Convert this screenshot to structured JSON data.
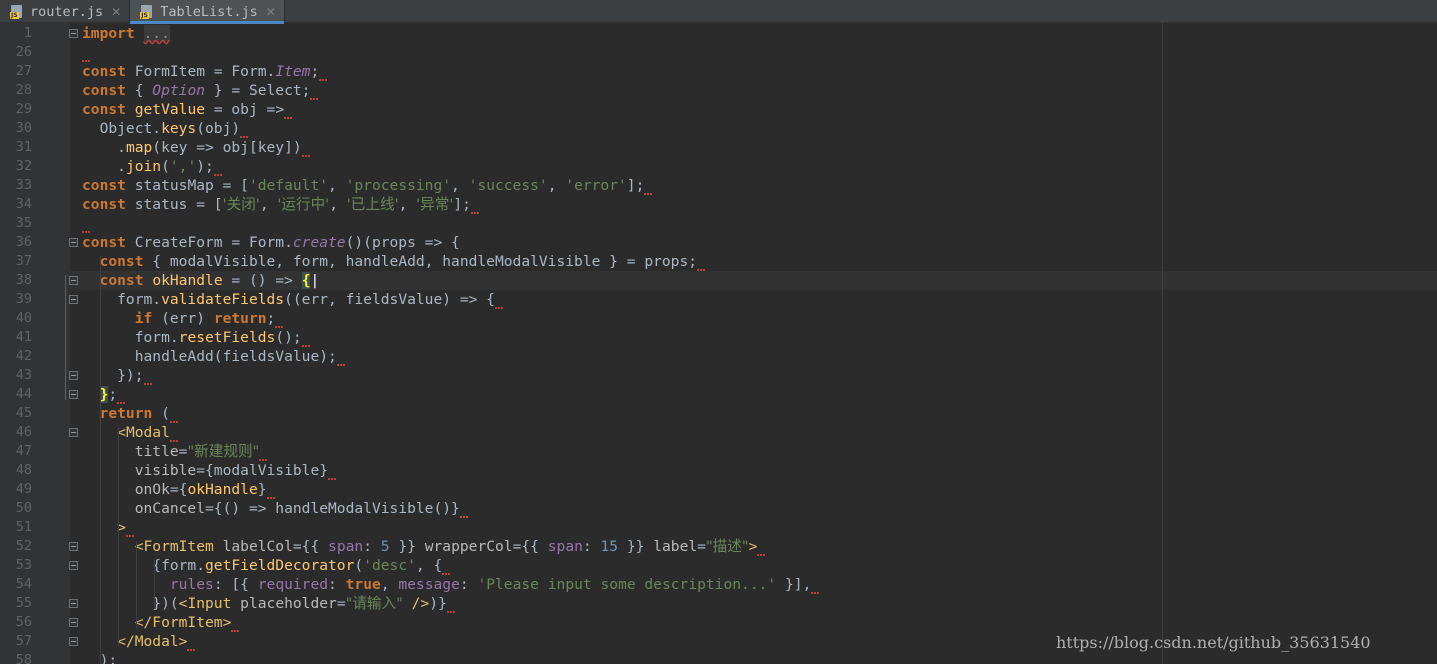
{
  "tabs": [
    {
      "label": "router.js",
      "icon": "js-file-icon",
      "active": false
    },
    {
      "label": "TableList.js",
      "icon": "js-file-icon",
      "active": true
    }
  ],
  "colors": {
    "background": "#2b2b2b",
    "keyword": "#cc7832",
    "string": "#6a8759",
    "number": "#6897bb",
    "property": "#9876aa",
    "function": "#ffc66d",
    "jsx_tag": "#e8bf6a"
  },
  "current_line": "38",
  "watermark": "https://blog.csdn.net/github_35631540",
  "lines": [
    {
      "n": "1",
      "fold": true,
      "tokens": [
        [
          "kw",
          "import"
        ],
        [
          "p",
          " "
        ],
        [
          "fold",
          "..."
        ]
      ]
    },
    {
      "n": "26",
      "tokens": [
        [
          "sq",
          ""
        ]
      ]
    },
    {
      "n": "27",
      "tokens": [
        [
          "kw",
          "const"
        ],
        [
          "p",
          " FormItem = Form."
        ],
        [
          "ital",
          "Item"
        ],
        [
          "p",
          ";"
        ],
        [
          "sq",
          ""
        ]
      ]
    },
    {
      "n": "28",
      "tokens": [
        [
          "kw",
          "const"
        ],
        [
          "p",
          " { "
        ],
        [
          "ital",
          "Option"
        ],
        [
          "p",
          " } = Select;"
        ],
        [
          "sq",
          ""
        ]
      ]
    },
    {
      "n": "29",
      "tokens": [
        [
          "kw",
          "const"
        ],
        [
          "p",
          " "
        ],
        [
          "fn",
          "getValue"
        ],
        [
          "p",
          " = obj =>"
        ],
        [
          "sq",
          ""
        ]
      ]
    },
    {
      "n": "30",
      "tokens": [
        [
          "p",
          "  Object."
        ],
        [
          "fn",
          "keys"
        ],
        [
          "p",
          "(obj)"
        ],
        [
          "sq",
          ""
        ]
      ]
    },
    {
      "n": "31",
      "tokens": [
        [
          "p",
          "    ."
        ],
        [
          "fn",
          "map"
        ],
        [
          "p",
          "(key => obj[key])"
        ],
        [
          "sq",
          ""
        ]
      ]
    },
    {
      "n": "32",
      "tokens": [
        [
          "p",
          "    ."
        ],
        [
          "fn",
          "join"
        ],
        [
          "p",
          "("
        ],
        [
          "str",
          "','"
        ],
        [
          "p",
          ");"
        ],
        [
          "sq",
          ""
        ]
      ]
    },
    {
      "n": "33",
      "tokens": [
        [
          "kw",
          "const"
        ],
        [
          "p",
          " statusMap = ["
        ],
        [
          "str",
          "'default'"
        ],
        [
          "p",
          ", "
        ],
        [
          "str",
          "'processing'"
        ],
        [
          "p",
          ", "
        ],
        [
          "str",
          "'success'"
        ],
        [
          "p",
          ", "
        ],
        [
          "str",
          "'error'"
        ],
        [
          "p",
          "];"
        ],
        [
          "sq",
          ""
        ]
      ]
    },
    {
      "n": "34",
      "tokens": [
        [
          "kw",
          "const"
        ],
        [
          "p",
          " status = ["
        ],
        [
          "str",
          "'关闭'"
        ],
        [
          "p",
          ", "
        ],
        [
          "str",
          "'运行中'"
        ],
        [
          "p",
          ", "
        ],
        [
          "str",
          "'已上线'"
        ],
        [
          "p",
          ", "
        ],
        [
          "str",
          "'异常'"
        ],
        [
          "p",
          "];"
        ],
        [
          "sq",
          ""
        ]
      ]
    },
    {
      "n": "35",
      "tokens": [
        [
          "sq",
          ""
        ]
      ]
    },
    {
      "n": "36",
      "fold": true,
      "tokens": [
        [
          "kw",
          "const"
        ],
        [
          "p",
          " CreateForm = Form."
        ],
        [
          "ital",
          "create"
        ],
        [
          "p",
          "()(props => {"
        ]
      ]
    },
    {
      "n": "37",
      "tokens": [
        [
          "p",
          "  "
        ],
        [
          "kw",
          "const"
        ],
        [
          "p",
          " { modalVisible, form, handleAdd, handleModalVisible } = props;"
        ],
        [
          "sq",
          ""
        ]
      ]
    },
    {
      "n": "38",
      "fold": true,
      "tokens": [
        [
          "p",
          "  "
        ],
        [
          "kw",
          "const"
        ],
        [
          "p",
          " "
        ],
        [
          "fn",
          "okHandle"
        ],
        [
          "p",
          " = () => "
        ],
        [
          "match",
          "{"
        ],
        [
          "caret",
          "|"
        ]
      ]
    },
    {
      "n": "39",
      "fold": true,
      "tokens": [
        [
          "p",
          "    form."
        ],
        [
          "fn",
          "validateFields"
        ],
        [
          "p",
          "((err, fieldsValue) => {"
        ],
        [
          "sq",
          ""
        ]
      ]
    },
    {
      "n": "40",
      "tokens": [
        [
          "p",
          "      "
        ],
        [
          "kw",
          "if"
        ],
        [
          "p",
          " (err) "
        ],
        [
          "kw",
          "return"
        ],
        [
          "p",
          ";"
        ],
        [
          "sq",
          ""
        ]
      ]
    },
    {
      "n": "41",
      "tokens": [
        [
          "p",
          "      form."
        ],
        [
          "fn",
          "resetFields"
        ],
        [
          "p",
          "();"
        ],
        [
          "sq",
          ""
        ]
      ]
    },
    {
      "n": "42",
      "tokens": [
        [
          "p",
          "      handleAdd(fieldsValue);"
        ],
        [
          "sq",
          ""
        ]
      ]
    },
    {
      "n": "43",
      "fold": true,
      "tokens": [
        [
          "p",
          "    });"
        ],
        [
          "sq",
          ""
        ]
      ]
    },
    {
      "n": "44",
      "fold": true,
      "tokens": [
        [
          "p",
          "  "
        ],
        [
          "match",
          "}"
        ],
        [
          "p",
          ";"
        ],
        [
          "sq",
          ""
        ]
      ]
    },
    {
      "n": "45",
      "tokens": [
        [
          "p",
          "  "
        ],
        [
          "kw",
          "return"
        ],
        [
          "p",
          " ("
        ],
        [
          "sq",
          ""
        ]
      ]
    },
    {
      "n": "46",
      "fold": true,
      "tokens": [
        [
          "p",
          "    "
        ],
        [
          "tag",
          "<Modal"
        ],
        [
          "sq",
          ""
        ]
      ]
    },
    {
      "n": "47",
      "tokens": [
        [
          "p",
          "      "
        ],
        [
          "attr",
          "title"
        ],
        [
          "p",
          "="
        ],
        [
          "str",
          "\"新建规则\""
        ],
        [
          "sq",
          ""
        ]
      ]
    },
    {
      "n": "48",
      "tokens": [
        [
          "p",
          "      "
        ],
        [
          "attr",
          "visible"
        ],
        [
          "p",
          "={modalVisible}"
        ],
        [
          "sq",
          ""
        ]
      ]
    },
    {
      "n": "49",
      "tokens": [
        [
          "p",
          "      "
        ],
        [
          "attr",
          "onOk"
        ],
        [
          "p",
          "={"
        ],
        [
          "fn",
          "okHandle"
        ],
        [
          "p",
          "}"
        ],
        [
          "sq",
          ""
        ]
      ]
    },
    {
      "n": "50",
      "tokens": [
        [
          "p",
          "      "
        ],
        [
          "attr",
          "onCancel"
        ],
        [
          "p",
          "={() => handleModalVisible()}"
        ],
        [
          "sq",
          ""
        ]
      ]
    },
    {
      "n": "51",
      "tokens": [
        [
          "p",
          "    "
        ],
        [
          "tag",
          ">"
        ],
        [
          "sq",
          ""
        ]
      ]
    },
    {
      "n": "52",
      "fold": true,
      "tokens": [
        [
          "p",
          "      "
        ],
        [
          "tag",
          "<FormItem"
        ],
        [
          "p",
          " "
        ],
        [
          "attr",
          "labelCol"
        ],
        [
          "p",
          "={{ "
        ],
        [
          "prop",
          "span"
        ],
        [
          "p",
          ": "
        ],
        [
          "num",
          "5"
        ],
        [
          "p",
          " }} "
        ],
        [
          "attr",
          "wrapperCol"
        ],
        [
          "p",
          "={{ "
        ],
        [
          "prop",
          "span"
        ],
        [
          "p",
          ": "
        ],
        [
          "num",
          "15"
        ],
        [
          "p",
          " }} "
        ],
        [
          "attr",
          "label"
        ],
        [
          "p",
          "="
        ],
        [
          "str",
          "\"描述\""
        ],
        [
          "tag",
          ">"
        ],
        [
          "sq",
          ""
        ]
      ]
    },
    {
      "n": "53",
      "fold": true,
      "tokens": [
        [
          "p",
          "        {form."
        ],
        [
          "fn",
          "getFieldDecorator"
        ],
        [
          "p",
          "("
        ],
        [
          "str",
          "'desc'"
        ],
        [
          "p",
          ", {"
        ],
        [
          "sq",
          ""
        ]
      ]
    },
    {
      "n": "54",
      "tokens": [
        [
          "p",
          "          "
        ],
        [
          "prop",
          "rules"
        ],
        [
          "p",
          ": [{ "
        ],
        [
          "prop",
          "required"
        ],
        [
          "p",
          ": "
        ],
        [
          "kw",
          "true"
        ],
        [
          "p",
          ", "
        ],
        [
          "prop",
          "message"
        ],
        [
          "p",
          ": "
        ],
        [
          "str",
          "'Please input some description...'"
        ],
        [
          "p",
          " }],"
        ],
        [
          "sq",
          ""
        ]
      ]
    },
    {
      "n": "55",
      "fold": true,
      "tokens": [
        [
          "p",
          "        })("
        ],
        [
          "tag",
          "<Input"
        ],
        [
          "p",
          " "
        ],
        [
          "attr",
          "placeholder"
        ],
        [
          "p",
          "="
        ],
        [
          "str",
          "\"请输入\""
        ],
        [
          "p",
          " "
        ],
        [
          "tag",
          "/>"
        ],
        [
          "p",
          ")}"
        ],
        [
          "sq",
          ""
        ]
      ]
    },
    {
      "n": "56",
      "fold": true,
      "tokens": [
        [
          "p",
          "      "
        ],
        [
          "tag",
          "</FormItem>"
        ],
        [
          "sq",
          ""
        ]
      ]
    },
    {
      "n": "57",
      "fold": true,
      "tokens": [
        [
          "p",
          "    "
        ],
        [
          "tag",
          "</Modal>"
        ],
        [
          "sq",
          ""
        ]
      ]
    },
    {
      "n": "58",
      "tokens": [
        [
          "p",
          "  );"
        ]
      ]
    }
  ]
}
